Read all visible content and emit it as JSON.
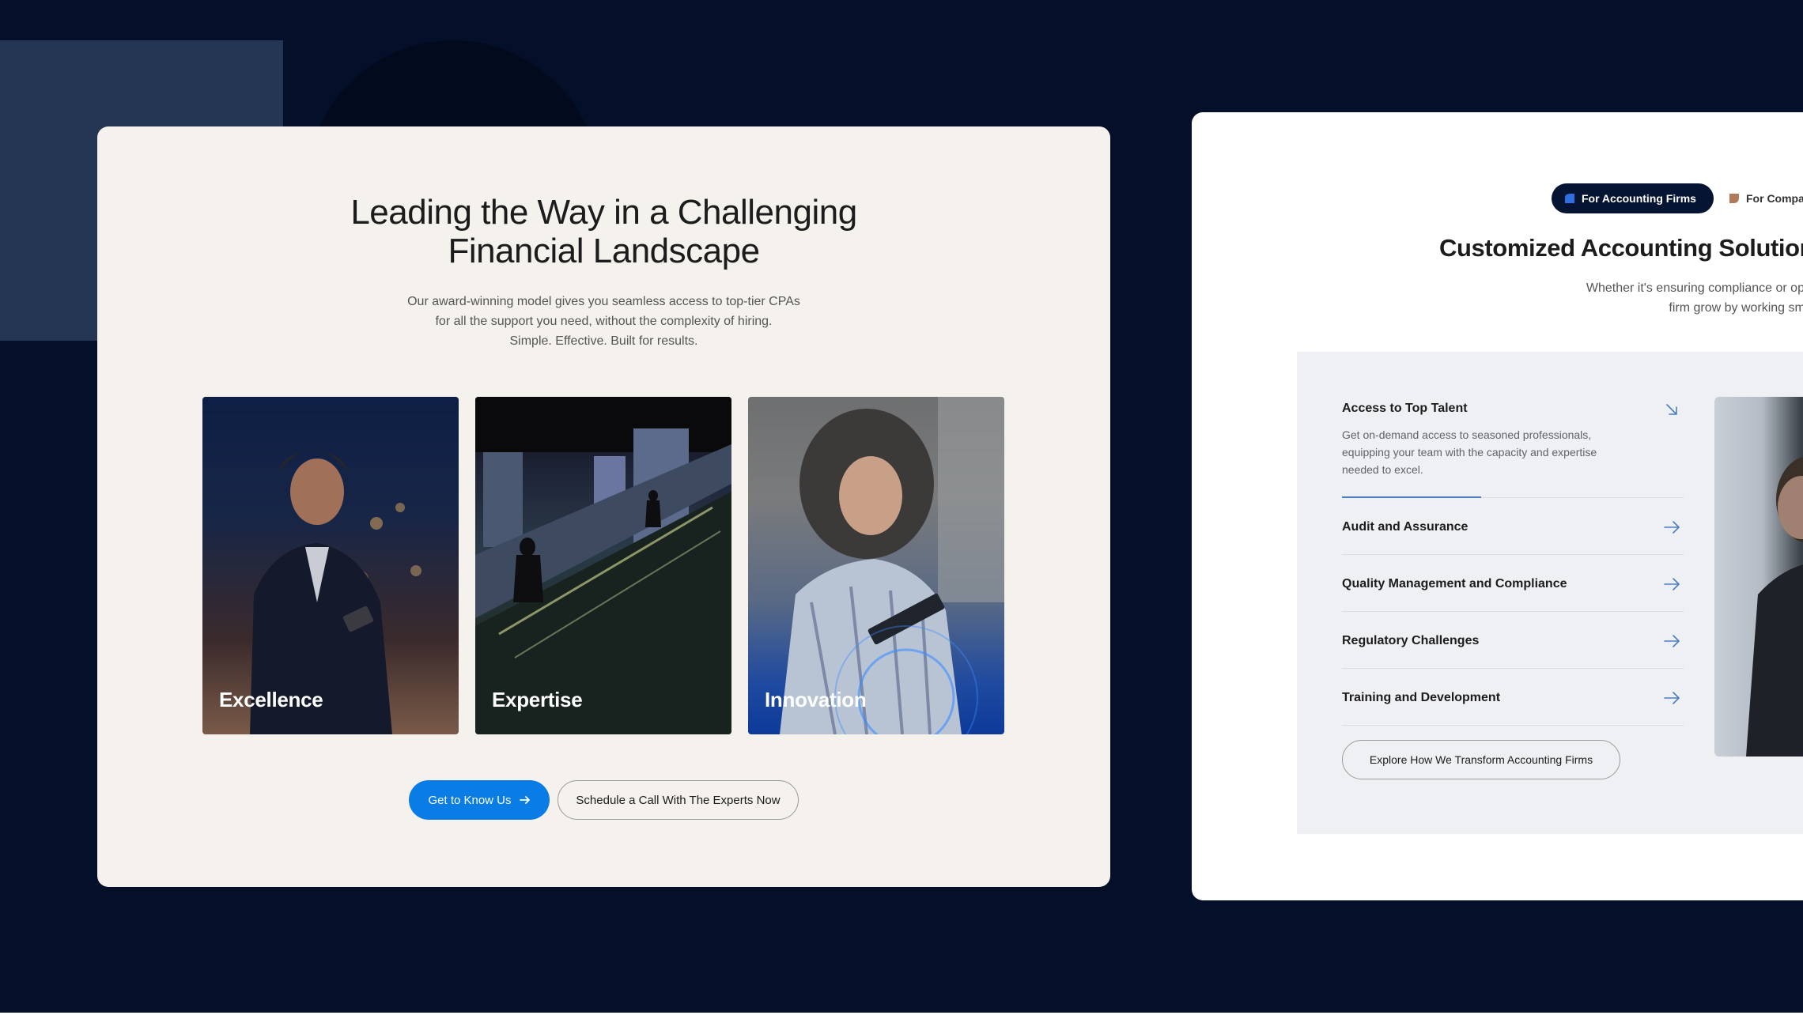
{
  "left_card": {
    "headline": [
      "Leading the Way in a Challenging",
      "Financial Landscape"
    ],
    "intro": [
      "Our award-winning model gives you seamless access to top-tier CPAs",
      "for all the support you need, without the complexity of hiring.",
      "Simple. Effective. Built for results."
    ],
    "tiles": [
      {
        "label": "Excellence"
      },
      {
        "label": "Expertise"
      },
      {
        "label": "Innovation"
      }
    ],
    "primary_button": "Get to Know Us",
    "secondary_button": "Schedule a Call With The Experts Now"
  },
  "right_card": {
    "tabs": [
      {
        "label": "For Accounting Firms",
        "active": true,
        "icon": "quarter-circle-icon"
      },
      {
        "label": "For Compa",
        "active": false,
        "icon": "quarter-circle-icon"
      }
    ],
    "title": "Customized Accounting Solutions",
    "intro": [
      "Whether it's ensuring compliance or optimizing resourc",
      "firm grow by working smarter at every st"
    ],
    "accordion": [
      {
        "title": "Access to Top Talent",
        "open": true,
        "description": [
          "Get on-demand access to seasoned professionals,",
          "equipping your team with the capacity and expertise",
          "needed to excel."
        ]
      },
      {
        "title": "Audit and Assurance",
        "open": false
      },
      {
        "title": "Quality Management and Compliance",
        "open": false
      },
      {
        "title": "Regulatory Challenges",
        "open": false
      },
      {
        "title": "Training and Development",
        "open": false
      }
    ],
    "explore_button": "Explore How We Transform Accounting Firms"
  },
  "colors": {
    "background": "#040f2a",
    "accent_blue": "#0a7ce6",
    "active_tab": "#051433",
    "arrow": "#4b7fc4"
  }
}
